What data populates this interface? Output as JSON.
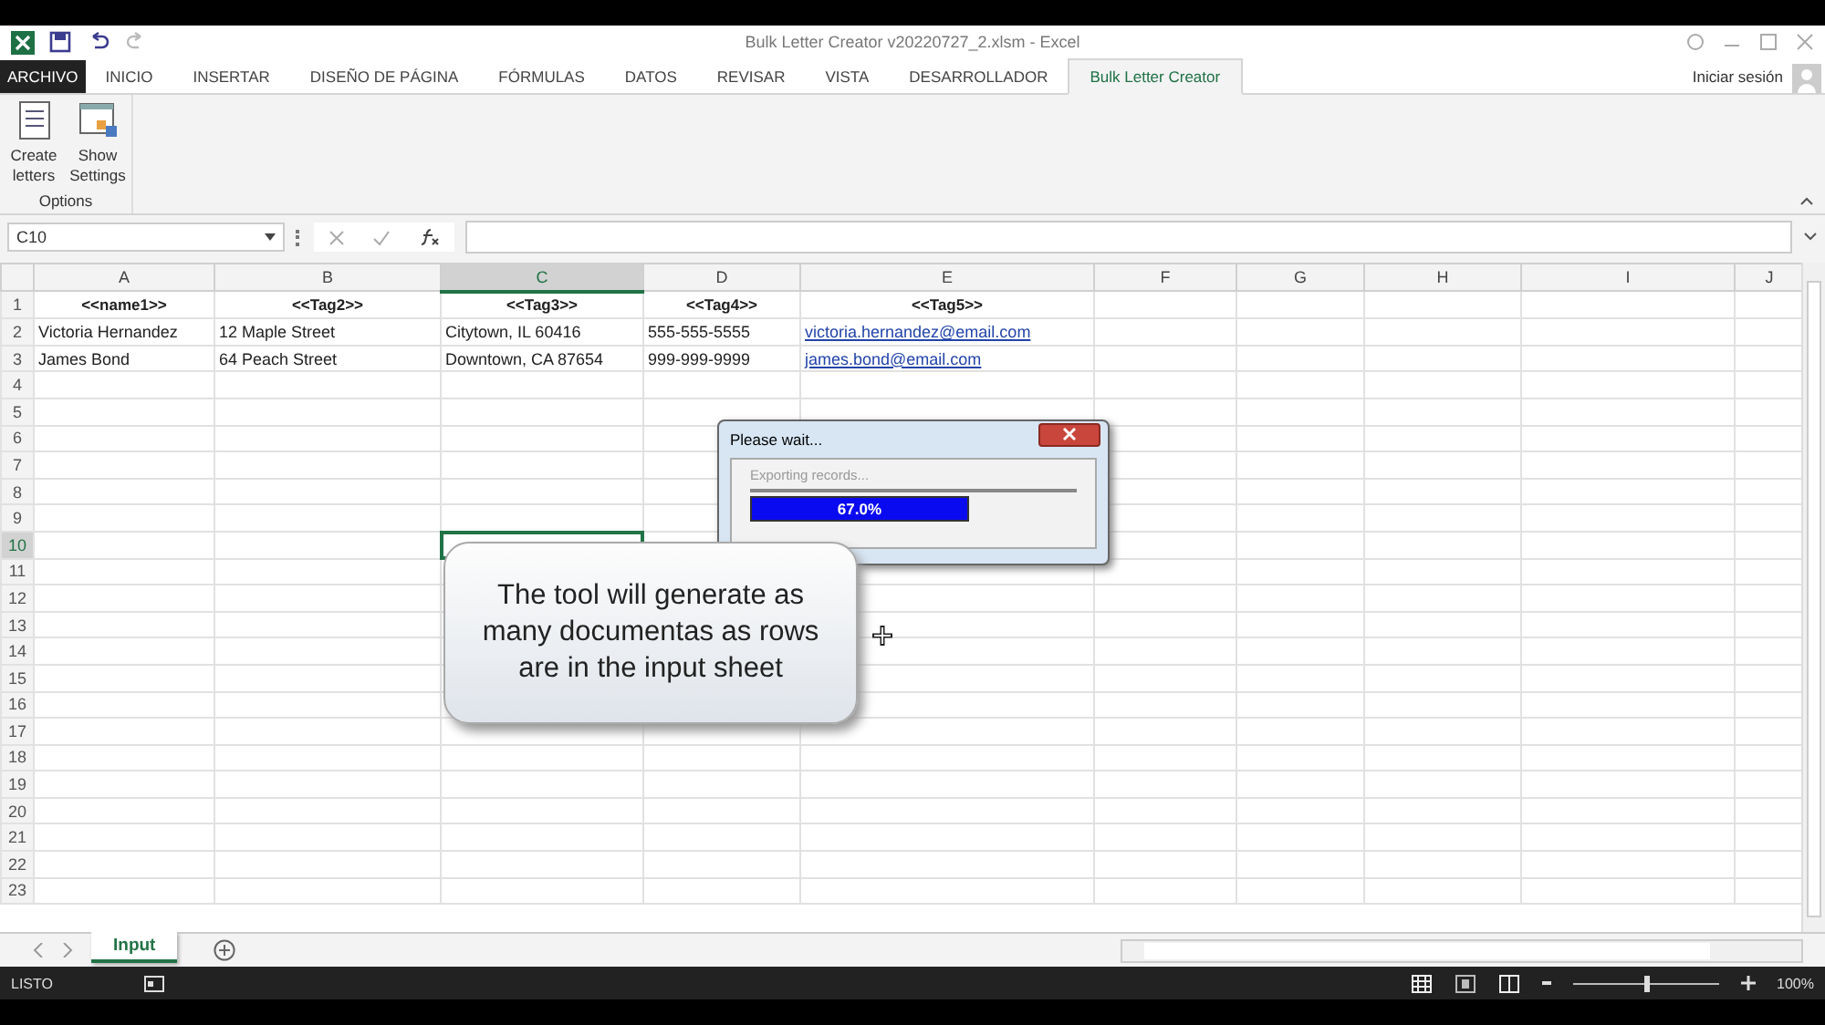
{
  "window": {
    "title": "Bulk Letter Creator v20220727_2.xlsm - Excel",
    "account": "Iniciar sesión"
  },
  "ribbon": {
    "tabs": [
      {
        "label": "ARCHIVO",
        "kind": "file",
        "selected": false
      },
      {
        "label": "INICIO",
        "kind": "tab",
        "selected": false
      },
      {
        "label": "INSERTAR",
        "kind": "tab",
        "selected": false
      },
      {
        "label": "DISEÑO DE PÁGINA",
        "kind": "tab",
        "selected": false
      },
      {
        "label": "FÓRMULAS",
        "kind": "tab",
        "selected": false
      },
      {
        "label": "DATOS",
        "kind": "tab",
        "selected": false
      },
      {
        "label": "REVISAR",
        "kind": "tab",
        "selected": false
      },
      {
        "label": "VISTA",
        "kind": "tab",
        "selected": false
      },
      {
        "label": "DESARROLLADOR",
        "kind": "tab",
        "selected": false
      },
      {
        "label": "Bulk Letter Creator",
        "kind": "tab",
        "selected": true
      }
    ],
    "group": {
      "label": "Options",
      "buttons": [
        {
          "label": "Create letters",
          "kind": "list"
        },
        {
          "label": "Show Settings",
          "kind": "settings"
        }
      ]
    }
  },
  "formula_bar": {
    "name_box": "C10"
  },
  "grid": {
    "columns": [
      {
        "label": "A",
        "selected": false
      },
      {
        "label": "B",
        "selected": false
      },
      {
        "label": "C",
        "selected": true
      },
      {
        "label": "D",
        "selected": false
      },
      {
        "label": "E",
        "selected": false
      },
      {
        "label": "F",
        "selected": false
      },
      {
        "label": "G",
        "selected": false
      },
      {
        "label": "H",
        "selected": false
      },
      {
        "label": "I",
        "selected": false
      },
      {
        "label": "J",
        "selected": false
      }
    ],
    "rows": [
      {
        "number": "1",
        "selected": false,
        "cells": [
          {
            "text": "<<name1>>",
            "kind": "header"
          },
          {
            "text": "<<Tag2>>",
            "kind": "header"
          },
          {
            "text": "<<Tag3>>",
            "kind": "header"
          },
          {
            "text": "<<Tag4>>",
            "kind": "header"
          },
          {
            "text": "<<Tag5>>",
            "kind": "header"
          }
        ]
      },
      {
        "number": "2",
        "selected": false,
        "cells": [
          {
            "text": "Victoria Hernandez",
            "kind": "text"
          },
          {
            "text": "12 Maple Street",
            "kind": "text"
          },
          {
            "text": "Citytown, IL 60416",
            "kind": "text"
          },
          {
            "text": "555-555-5555",
            "kind": "text"
          },
          {
            "text": "victoria.hernandez@email.com",
            "kind": "link"
          }
        ]
      },
      {
        "number": "3",
        "selected": false,
        "cells": [
          {
            "text": "James Bond",
            "kind": "text"
          },
          {
            "text": "64 Peach Street",
            "kind": "text"
          },
          {
            "text": "Downtown, CA 87654",
            "kind": "text"
          },
          {
            "text": "999-999-9999",
            "kind": "text"
          },
          {
            "text": "james.bond@email.com",
            "kind": "link"
          }
        ]
      },
      {
        "number": "4",
        "selected": false
      },
      {
        "number": "5",
        "selected": false
      },
      {
        "number": "6",
        "selected": false
      },
      {
        "number": "7",
        "selected": false
      },
      {
        "number": "8",
        "selected": false
      },
      {
        "number": "9",
        "selected": false
      },
      {
        "number": "10",
        "selected": true
      },
      {
        "number": "11",
        "selected": false
      },
      {
        "number": "12",
        "selected": false
      },
      {
        "number": "13",
        "selected": false
      },
      {
        "number": "14",
        "selected": false
      },
      {
        "number": "15",
        "selected": false
      },
      {
        "number": "16",
        "selected": false
      },
      {
        "number": "17",
        "selected": false
      },
      {
        "number": "18",
        "selected": false
      },
      {
        "number": "19",
        "selected": false
      },
      {
        "number": "20",
        "selected": false
      },
      {
        "number": "21",
        "selected": false
      },
      {
        "number": "22",
        "selected": false
      },
      {
        "number": "23",
        "selected": false
      }
    ]
  },
  "dialog": {
    "title": "Please wait...",
    "message": "Exporting records...",
    "progress": {
      "level": 0.67,
      "reading": "67.0%"
    }
  },
  "callout": {
    "text": "The tool will generate as many documentas as rows are in the input sheet"
  },
  "sheet_tabs": [
    {
      "label": "Input",
      "selected": true
    }
  ],
  "status_bar": {
    "status": "LISTO",
    "zoom": {
      "level": 0.5,
      "reading": "100%"
    }
  }
}
